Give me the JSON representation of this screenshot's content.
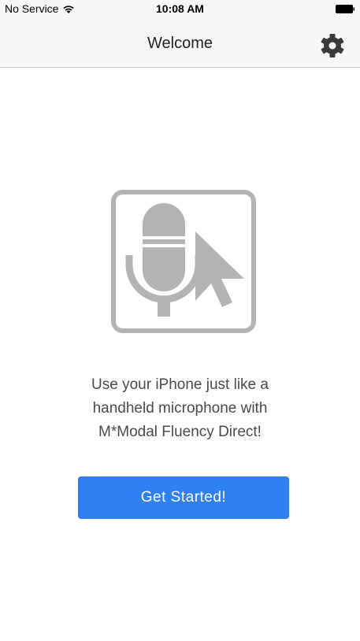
{
  "status_bar": {
    "carrier": "No Service",
    "time": "10:08 AM",
    "wifi_icon": "wifi-icon",
    "battery_icon": "battery-icon"
  },
  "nav": {
    "title": "Welcome",
    "settings_icon": "gear-icon"
  },
  "main": {
    "logo_icon": "microphone-cursor-icon",
    "message_lines": [
      "Use your iPhone just like a",
      "handheld microphone with",
      "M*Modal Fluency Direct!"
    ],
    "button_label": "Get Started!"
  },
  "colors": {
    "accent": "#2f80f5",
    "icon_gray": "#b3b3b3",
    "text": "#4a4a4a",
    "bar_background": "#f7f7f7"
  }
}
